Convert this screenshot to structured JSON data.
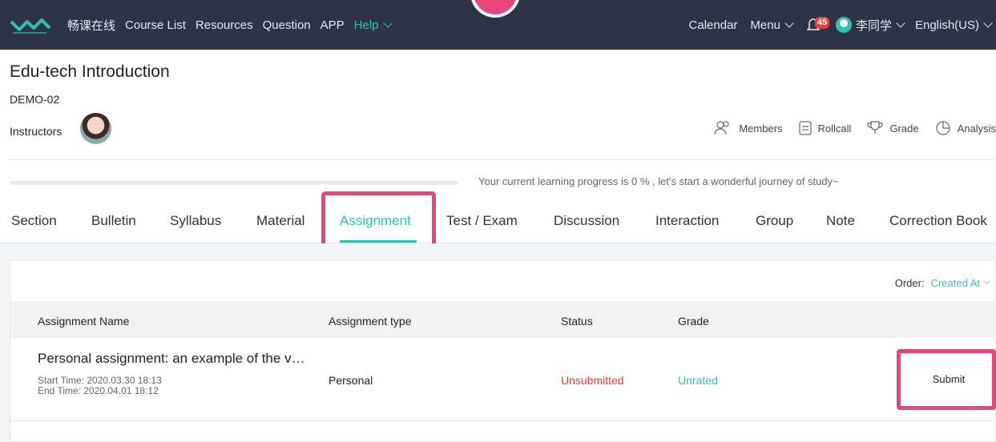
{
  "nav": {
    "brand": "畅课在线",
    "course_list": "Course List",
    "resources": "Resources",
    "question": "Question",
    "app": "APP",
    "help": "Help",
    "calendar": "Calendar",
    "menu": "Menu",
    "notification_count": "45",
    "user": "李同学",
    "language": "English(US)"
  },
  "course": {
    "title": "Edu-tech Introduction",
    "code": "DEMO-02",
    "instructors_label": "Instructors"
  },
  "tools": {
    "members": "Members",
    "rollcall": "Rollcall",
    "grade": "Grade",
    "analysis": "Analysis"
  },
  "progress": {
    "percent": 0,
    "text": "Your current learning progress is 0 % , let's start a wonderful journey of study~"
  },
  "tabs": [
    "Section",
    "Bulletin",
    "Syllabus",
    "Material",
    "Assignment",
    "Test / Exam",
    "Discussion",
    "Interaction",
    "Group",
    "Note",
    "Correction Book"
  ],
  "active_tab": "Assignment",
  "order": {
    "label": "Order:",
    "value": "Created At"
  },
  "table": {
    "headers": {
      "name": "Assignment Name",
      "type": "Assignment type",
      "status": "Status",
      "grade": "Grade"
    },
    "rows": [
      {
        "name": "Personal assignment: an example of the v…",
        "start_time": "Start Time:  2020.03.30 18:13",
        "end_time": "End Time:  2020.04.01 18:12",
        "type": "Personal",
        "status": "Unsubmitted",
        "grade": "Unrated",
        "action": "Submit"
      }
    ]
  },
  "colors": {
    "nav_bg": "#2d3446",
    "accent": "#2fc1b3",
    "status_red": "#e5383b",
    "highlight": "#e8457a",
    "badge": "#f04134"
  }
}
